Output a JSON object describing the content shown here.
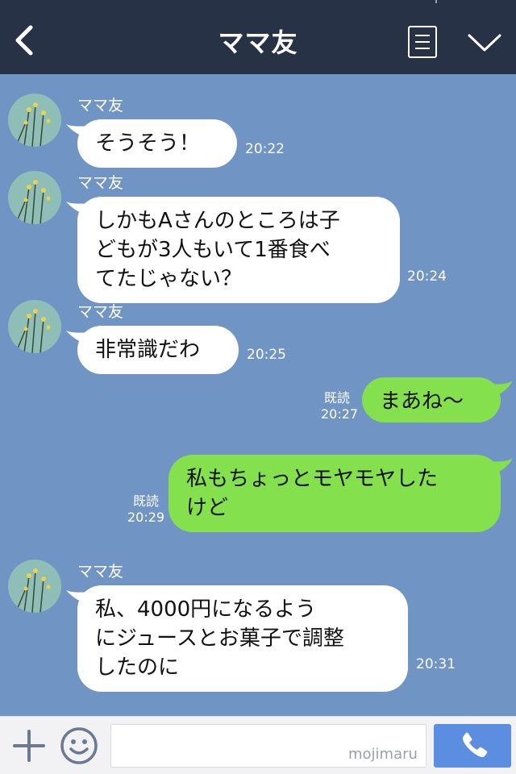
{
  "header": {
    "title": "ママ友"
  },
  "messages": [
    {
      "sender": "ママ友",
      "text": "そうそう！",
      "time": "20:22"
    },
    {
      "sender": "ママ友",
      "text": "しかもAさんのところは子\nどもが3人もいて1番食べ\nてたじゃない？",
      "time": "20:24"
    },
    {
      "sender": "ママ友",
      "text": "非常識だわ",
      "time": "20:25"
    },
    {
      "read": "既読",
      "text": "まあね〜",
      "time": "20:27"
    },
    {
      "read": "既読",
      "text": "私もちょっとモヤモヤした\nけど",
      "time": "20:29"
    },
    {
      "sender": "ママ友",
      "text": "私、4000円になるよう\nにジュースとお菓子で調整\nしたのに",
      "time": "20:31"
    }
  ],
  "footer": {
    "input_placeholder": "",
    "watermark": "mojimaru"
  },
  "colors": {
    "header": "#273246",
    "chat_bg": "#7094c3",
    "incoming": "#ffffff",
    "outgoing": "#84e04c",
    "call_button": "#5b8ee0"
  },
  "icons": {
    "back": "chevron-left-icon",
    "menu": "list-icon",
    "more": "chevron-down-icon",
    "add": "plus-icon",
    "emoji": "smiley-icon",
    "call": "phone-icon"
  }
}
